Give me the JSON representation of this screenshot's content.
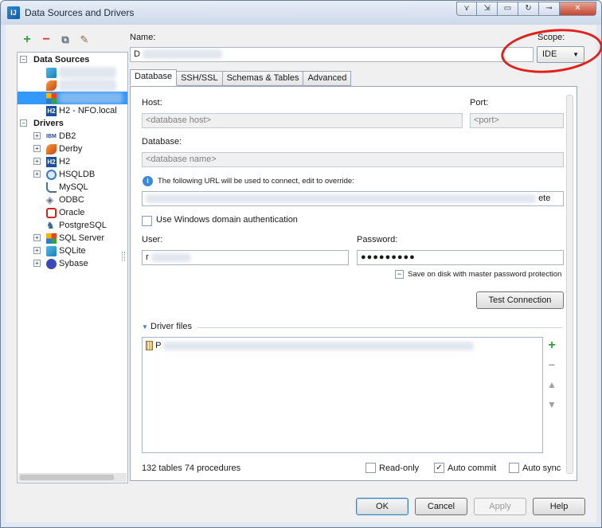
{
  "window": {
    "title": "Data Sources and Drivers",
    "close_label": "✕"
  },
  "toolbar": {
    "add": "+",
    "remove": "−"
  },
  "tree": {
    "data_sources_label": "Data Sources",
    "h2_fragment": "H2 - NFO.local",
    "drivers_label": "Drivers",
    "drivers": [
      "DB2",
      "Derby",
      "H2",
      "HSQLDB",
      "MySQL",
      "ODBC",
      "Oracle",
      "PostgreSQL",
      "SQL Server",
      "SQLite",
      "Sybase"
    ]
  },
  "form": {
    "name_label": "Name:",
    "name_value": "D",
    "scope_label": "Scope:",
    "scope_value": "IDE",
    "tabs": [
      "Database",
      "SSH/SSL",
      "Schemas & Tables",
      "Advanced"
    ],
    "host_label": "Host:",
    "host_placeholder": "<database host>",
    "port_label": "Port:",
    "port_placeholder": "<port>",
    "database_label": "Database:",
    "database_placeholder": "<database name>",
    "url_info": "The following URL will be used to connect, edit to override:",
    "url_tail": "ete",
    "windows_auth_label": "Use Windows domain authentication",
    "user_label": "User:",
    "user_value": "r",
    "password_label": "Password:",
    "password_value": "●●●●●●●●●",
    "save_on_disk_label": "Save on disk with master password protection",
    "test_connection_label": "Test Connection",
    "driver_files_label": "Driver files",
    "driver_file_first_char": "P",
    "status_text": "132 tables 74 procedures",
    "readonly_label": "Read-only",
    "auto_commit_label": "Auto commit",
    "auto_sync_label": "Auto sync"
  },
  "buttons": {
    "ok": "OK",
    "cancel": "Cancel",
    "apply": "Apply",
    "help": "Help"
  },
  "colors": {
    "accent_selection": "#3399ff",
    "highlight_ellipse": "#e0201a"
  }
}
